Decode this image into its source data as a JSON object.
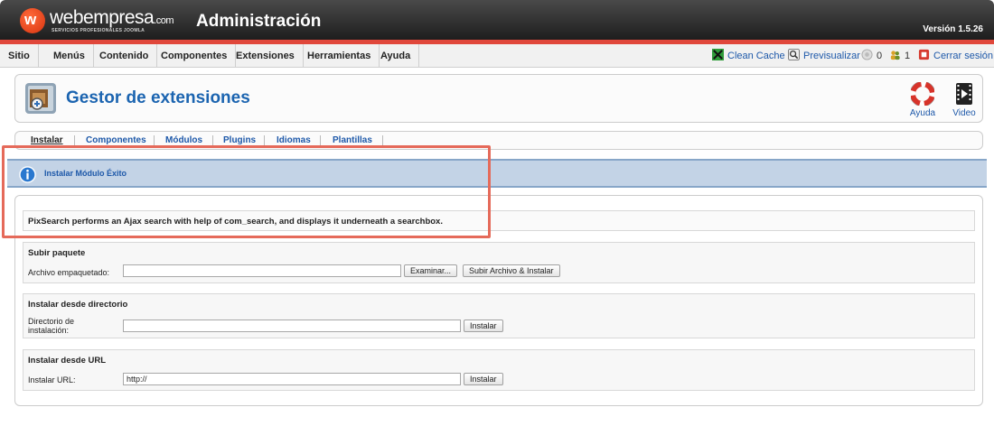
{
  "header": {
    "logo_mark": "w",
    "logo_name": "webempresa",
    "logo_domain": ".com",
    "logo_tagline": "SERVICIOS PROFESIONALES JOOMLA",
    "title": "Administración",
    "version": "Versión 1.5.26"
  },
  "menu": {
    "items": [
      "Sitio",
      "Menús",
      "Contenido",
      "Componentes",
      "Extensiones",
      "Herramientas",
      "Ayuda"
    ],
    "right": {
      "clean_cache": "Clean Cache",
      "preview": "Previsualizar",
      "messages_count": "0",
      "users_count": "1",
      "logout": "Cerrar sesión"
    }
  },
  "toolbar": {
    "title": "Gestor de extensiones",
    "help_label": "Ayuda",
    "video_label": "Video"
  },
  "tabs": [
    "Instalar",
    "Componentes",
    "Módulos",
    "Plugins",
    "Idiomas",
    "Plantillas"
  ],
  "message": {
    "text": "Instalar Módulo Éxito",
    "description": "PixSearch performs an Ajax search with help of com_search, and displays it underneath a searchbox."
  },
  "upload": {
    "legend": "Subir paquete",
    "label": "Archivo empaquetado:",
    "browse_label": "Examinar...",
    "submit_label": "Subir Archivo & Instalar"
  },
  "directory": {
    "legend": "Instalar desde directorio",
    "label": "Directorio de instalación:",
    "value": "",
    "submit_label": "Instalar"
  },
  "url": {
    "legend": "Instalar desde URL",
    "label": "Instalar URL:",
    "value": "http://",
    "submit_label": "Instalar"
  },
  "colors": {
    "accent_red": "#e0473b",
    "link_blue": "#1d58a9",
    "message_bg": "#c3d3e6",
    "annotation": "#e56a5a"
  },
  "icons": {
    "clean_cache": "broom-icon",
    "preview": "magnifier-icon",
    "messages": "message-icon",
    "users": "users-icon",
    "logout": "logout-icon",
    "help": "lifebuoy-icon",
    "video": "film-icon",
    "extensions": "extensions-icon",
    "info": "info-icon"
  }
}
